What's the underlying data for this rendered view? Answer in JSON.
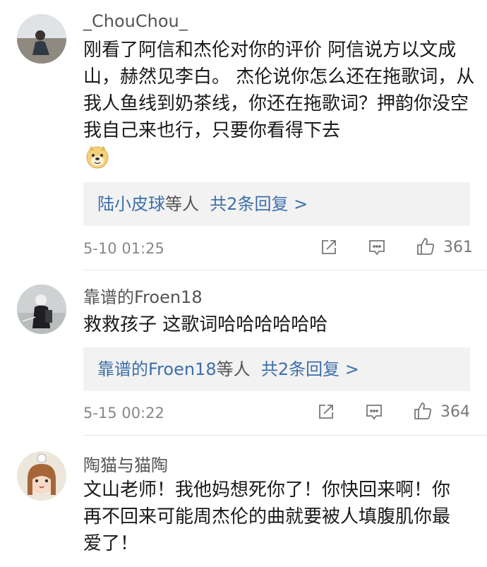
{
  "comments": [
    {
      "username": "_ChouChou_",
      "text": "刚看了阿信和杰伦对你的评价 阿信说方以文成山，赫然见李白。 杰伦说你怎么还在拖歌词，从我人鱼线到奶茶线，你还在拖歌词？押韵你没空我自己来也行，只要你看得下去",
      "emoji": "doge-emoji",
      "reply_names": "陆小皮球",
      "reply_suffix": "等人",
      "reply_count": "共2条回复 >",
      "time": "5-10 01:25",
      "likes": "361"
    },
    {
      "username": "靠谱的Froen18",
      "text": "救救孩子 这歌词哈哈哈哈哈哈",
      "reply_names": "靠谱的Froen18",
      "reply_suffix": "等人",
      "reply_count": "共2条回复 >",
      "time": "5-15 00:22",
      "likes": "364"
    },
    {
      "username": "陶猫与猫陶",
      "text": "文山老师！我他妈想死你了！你快回来啊！你再不回来可能周杰伦的曲就要被人填腹肌你最爱了！"
    }
  ],
  "icons": {
    "share": "share-icon",
    "comment": "comment-icon",
    "like": "thumb-up-icon"
  }
}
